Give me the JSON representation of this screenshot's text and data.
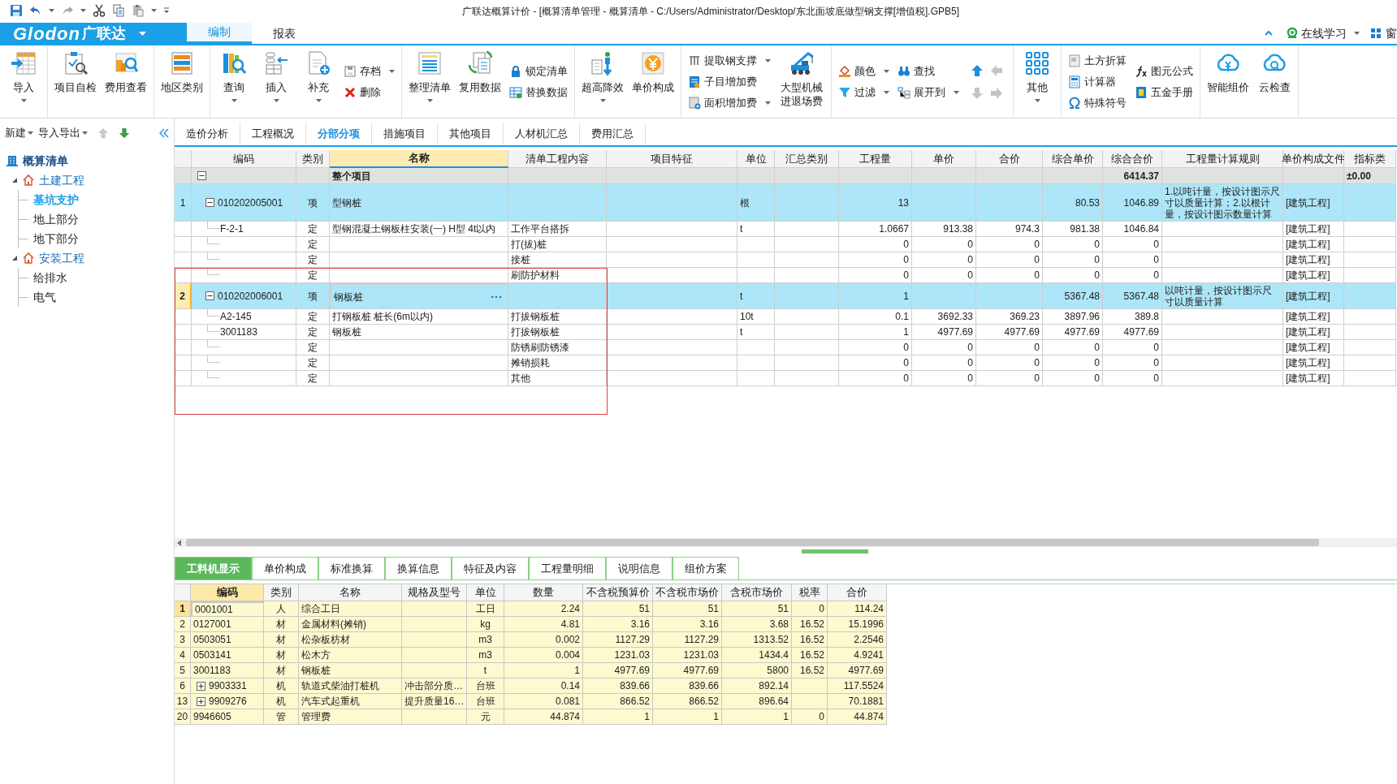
{
  "window": {
    "title": "广联达概算计价 - [概算清单管理 - 概算清单 - C:/Users/Administrator/Desktop/东北面坡底做型钢支撑[增值税].GPB5]"
  },
  "menu": {
    "logo_latin": "Glodon",
    "logo_cn": "广联达",
    "tabs": [
      {
        "label": "编制",
        "selected": true
      },
      {
        "label": "报表",
        "selected": false
      }
    ],
    "right": [
      {
        "kind": "learn",
        "label": "在线学习",
        "dropdown": true
      },
      {
        "kind": "window",
        "label": "窗"
      }
    ]
  },
  "ribbon": [
    {
      "items": [
        {
          "kind": "large",
          "label": "导入",
          "dropdown": true
        }
      ]
    },
    {
      "items": [
        {
          "kind": "large",
          "label": "项目自检",
          "dropdown": false
        },
        {
          "kind": "large",
          "label": "费用查看",
          "dropdown": false
        }
      ]
    },
    {
      "items": [
        {
          "kind": "large",
          "label": "地区类别",
          "dropdown": false
        }
      ]
    },
    {
      "items": [
        {
          "kind": "large",
          "label": "查询",
          "dropdown": true
        },
        {
          "kind": "large",
          "label": "插入",
          "dropdown": true
        },
        {
          "kind": "large",
          "label": "补充",
          "dropdown": true
        },
        {
          "kind": "stack",
          "entries": [
            {
              "label": "存档",
              "dropdown": true
            },
            {
              "label": "删除",
              "dropdown": false
            }
          ]
        }
      ]
    },
    {
      "items": [
        {
          "kind": "large",
          "label": "整理清单",
          "dropdown": true
        },
        {
          "kind": "large",
          "label": "复用数据",
          "dropdown": false
        },
        {
          "kind": "stack",
          "entries": [
            {
              "label": "锁定清单",
              "dropdown": false
            },
            {
              "label": "替换数据",
              "dropdown": false
            }
          ]
        }
      ]
    },
    {
      "items": [
        {
          "kind": "large",
          "label": "超高降效",
          "dropdown": true
        },
        {
          "kind": "large",
          "label": "单价构成",
          "dropdown": false
        }
      ]
    },
    {
      "items": [
        {
          "kind": "stack",
          "entries": [
            {
              "label": "提取钢支撑",
              "dropdown": true
            },
            {
              "label": "子目增加费",
              "dropdown": false
            },
            {
              "label": "面积增加费",
              "dropdown": true
            }
          ]
        },
        {
          "kind": "large",
          "label": "大型机械进退场费",
          "dropdown": false
        }
      ]
    },
    {
      "items": [
        {
          "kind": "stack",
          "entries": [
            {
              "label": "颜色",
              "dropdown": true
            },
            {
              "label": "过滤",
              "dropdown": true
            }
          ]
        },
        {
          "kind": "stack",
          "entries": [
            {
              "label": "查找",
              "dropdown": false
            },
            {
              "label": "展开到",
              "dropdown": true
            }
          ]
        },
        {
          "kind": "arrows",
          "buttons": [
            {
              "disabled": false
            },
            {
              "disabled": true
            },
            {
              "disabled": true
            },
            {
              "disabled": true
            }
          ]
        }
      ]
    },
    {
      "items": [
        {
          "kind": "large",
          "label": "其他",
          "dropdown": true
        }
      ]
    },
    {
      "items": [
        {
          "kind": "stack",
          "entries": [
            {
              "label": "土方折算",
              "dropdown": false
            },
            {
              "label": "计算器",
              "dropdown": false
            },
            {
              "label": "特殊符号",
              "dropdown": false
            }
          ]
        },
        {
          "kind": "stack",
          "entries": [
            {
              "label": "图元公式",
              "dropdown": false
            },
            {
              "label": "五金手册",
              "dropdown": false
            }
          ]
        }
      ]
    },
    {
      "items": [
        {
          "kind": "large",
          "label": "智能组价",
          "dropdown": false
        },
        {
          "kind": "large",
          "label": "云检查",
          "dropdown": false
        }
      ]
    }
  ],
  "sidebar": {
    "toolbar": [
      {
        "label": "新建",
        "dropdown": true
      },
      {
        "label": "导入导出",
        "dropdown": true
      }
    ],
    "move_buttons": [
      {
        "disabled": true
      },
      {
        "disabled": false
      }
    ],
    "tree": {
      "label": "概算清单",
      "children": [
        {
          "label": "土建工程",
          "expanded": true,
          "selected": false,
          "children": [
            {
              "label": "基坑支护",
              "selected": true
            },
            {
              "label": "地上部分",
              "selected": false
            },
            {
              "label": "地下部分",
              "selected": false
            }
          ]
        },
        {
          "label": "安装工程",
          "expanded": true,
          "selected": false,
          "children": [
            {
              "label": "给排水",
              "selected": false
            },
            {
              "label": "电气",
              "selected": false
            }
          ]
        }
      ]
    }
  },
  "tabs": [
    {
      "label": "造价分析",
      "selected": false
    },
    {
      "label": "工程概况",
      "selected": false
    },
    {
      "label": "分部分项",
      "selected": true
    },
    {
      "label": "措施项目",
      "selected": false
    },
    {
      "label": "其他项目",
      "selected": false
    },
    {
      "label": "人材机汇总",
      "selected": false
    },
    {
      "label": "费用汇总",
      "selected": false
    }
  ],
  "table": {
    "columns": [
      {
        "label": "编码",
        "selected": false
      },
      {
        "label": "类别",
        "selected": false
      },
      {
        "label": "名称",
        "selected": true
      },
      {
        "label": "清单工程内容",
        "selected": false
      },
      {
        "label": "项目特征",
        "selected": false
      },
      {
        "label": "单位",
        "selected": false
      },
      {
        "label": "汇总类别",
        "selected": false
      },
      {
        "label": "工程量",
        "selected": false
      },
      {
        "label": "单价",
        "selected": false
      },
      {
        "label": "合价",
        "selected": false
      },
      {
        "label": "综合单价",
        "selected": false
      },
      {
        "label": "综合合价",
        "selected": false
      },
      {
        "label": "工程量计算规则",
        "selected": false
      },
      {
        "label": "单价构成文件",
        "selected": false
      },
      {
        "label": "指标类",
        "selected": false
      }
    ],
    "rows": [
      {
        "kind": "group",
        "selected": false,
        "expanded": true,
        "name": "整个项目",
        "comp_total": "6414.37",
        "index": "±0.00"
      },
      {
        "kind": "item",
        "selected": false,
        "expanded": true,
        "no": "1",
        "code": "010202005001",
        "type": "项",
        "name": "型钢桩",
        "unit": "根",
        "qty": "13",
        "comp_price": "80.53",
        "comp_total": "1046.89",
        "rule": "1.以吨计量，按设计图示尺寸以质量计算；2.以根计量，按设计图示数量计算",
        "file": "[建筑工程]"
      },
      {
        "kind": "sub",
        "selected": false,
        "code": "F-2-1",
        "type": "定",
        "name": "型钢混凝土钢板柱安装(一) H型 4t以内",
        "content": "工作平台搭拆",
        "unit": "t",
        "qty": "1.0667",
        "price": "913.38",
        "total": "974.3",
        "comp_price": "981.38",
        "comp_total": "1046.84",
        "file": "[建筑工程]"
      },
      {
        "kind": "sub",
        "selected": false,
        "type": "定",
        "content": "打(拔)桩",
        "qty": "0",
        "price": "0",
        "total": "0",
        "comp_price": "0",
        "comp_total": "0",
        "file": "[建筑工程]"
      },
      {
        "kind": "sub",
        "selected": false,
        "type": "定",
        "content": "接桩",
        "qty": "0",
        "price": "0",
        "total": "0",
        "comp_price": "0",
        "comp_total": "0",
        "file": "[建筑工程]"
      },
      {
        "kind": "sub",
        "selected": false,
        "type": "定",
        "content": "刷防护材料",
        "qty": "0",
        "price": "0",
        "total": "0",
        "comp_price": "0",
        "comp_total": "0",
        "file": "[建筑工程]"
      },
      {
        "kind": "item",
        "selected": true,
        "expanded": true,
        "no": "2",
        "code": "010202006001",
        "type": "项",
        "name": "钢板桩",
        "unit": "t",
        "qty": "1",
        "comp_price": "5367.48",
        "comp_total": "5367.48",
        "rule": "以吨计量，按设计图示尺寸以质量计算",
        "file": "[建筑工程]"
      },
      {
        "kind": "sub",
        "selected": false,
        "code": "A2-145",
        "type": "定",
        "name": "打钢板桩 桩长(6m以内)",
        "content": "打拔钢板桩",
        "unit": "10t",
        "qty": "0.1",
        "price": "3692.33",
        "total": "369.23",
        "comp_price": "3897.96",
        "comp_total": "389.8",
        "file": "[建筑工程]"
      },
      {
        "kind": "sub",
        "selected": false,
        "code": "3001183",
        "type": "定",
        "name": "钢板桩",
        "content": "打拔钢板桩",
        "unit": "t",
        "qty": "1",
        "price": "4977.69",
        "total": "4977.69",
        "comp_price": "4977.69",
        "comp_total": "4977.69",
        "file": "[建筑工程]"
      },
      {
        "kind": "sub",
        "selected": false,
        "type": "定",
        "content": "防锈刷防锈漆",
        "qty": "0",
        "price": "0",
        "total": "0",
        "comp_price": "0",
        "comp_total": "0",
        "file": "[建筑工程]"
      },
      {
        "kind": "sub",
        "selected": false,
        "type": "定",
        "content": "摊销损耗",
        "qty": "0",
        "price": "0",
        "total": "0",
        "comp_price": "0",
        "comp_total": "0",
        "file": "[建筑工程]"
      },
      {
        "kind": "sub",
        "selected": false,
        "type": "定",
        "content": "其他",
        "qty": "0",
        "price": "0",
        "total": "0",
        "comp_price": "0",
        "comp_total": "0",
        "file": "[建筑工程]"
      }
    ]
  },
  "detail_tabs": [
    {
      "label": "工料机显示",
      "selected": true
    },
    {
      "label": "单价构成",
      "selected": false
    },
    {
      "label": "标准换算",
      "selected": false
    },
    {
      "label": "换算信息",
      "selected": false
    },
    {
      "label": "特征及内容",
      "selected": false
    },
    {
      "label": "工程量明细",
      "selected": false
    },
    {
      "label": "说明信息",
      "selected": false
    },
    {
      "label": "组价方案",
      "selected": false
    }
  ],
  "detail_table": {
    "columns": [
      {
        "label": "编码",
        "selected": true
      },
      {
        "label": "类别",
        "selected": false
      },
      {
        "label": "名称",
        "selected": false
      },
      {
        "label": "规格及型号",
        "selected": false
      },
      {
        "label": "单位",
        "selected": false
      },
      {
        "label": "数量",
        "selected": false
      },
      {
        "label": "不含税预算价",
        "selected": false
      },
      {
        "label": "不含税市场价",
        "selected": false
      },
      {
        "label": "含税市场价",
        "selected": false
      },
      {
        "label": "税率",
        "selected": false
      },
      {
        "label": "合价",
        "selected": false
      }
    ],
    "rows": [
      {
        "no": "1",
        "selected": true,
        "code": "0001001",
        "type": "人",
        "name": "综合工日",
        "unit": "工日",
        "qty": "2.24",
        "budget": "51",
        "market": "51",
        "market_tax": "51",
        "rate": "0",
        "total": "114.24"
      },
      {
        "no": "2",
        "selected": false,
        "code": "0127001",
        "type": "材",
        "name": "金属材料(摊销)",
        "unit": "kg",
        "qty": "4.81",
        "budget": "3.16",
        "market": "3.16",
        "market_tax": "3.68",
        "rate": "16.52",
        "total": "15.1996"
      },
      {
        "no": "3",
        "selected": false,
        "code": "0503051",
        "type": "材",
        "name": "松杂板枋材",
        "unit": "m3",
        "qty": "0.002",
        "budget": "1127.29",
        "market": "1127.29",
        "market_tax": "1313.52",
        "rate": "16.52",
        "total": "2.2546"
      },
      {
        "no": "4",
        "selected": false,
        "code": "0503141",
        "type": "材",
        "name": "松木方",
        "unit": "m3",
        "qty": "0.004",
        "budget": "1231.03",
        "market": "1231.03",
        "market_tax": "1434.4",
        "rate": "16.52",
        "total": "4.9241"
      },
      {
        "no": "5",
        "selected": false,
        "code": "3001183",
        "type": "材",
        "name": "钢板桩",
        "unit": "t",
        "qty": "1",
        "budget": "4977.69",
        "market": "4977.69",
        "market_tax": "5800",
        "rate": "16.52",
        "total": "4977.69"
      },
      {
        "no": "6",
        "selected": false,
        "expanded": false,
        "code": "9903331",
        "type": "机",
        "name": "轨道式柴油打桩机",
        "spec": "冲击部分质…",
        "unit": "台班",
        "qty": "0.14",
        "budget": "839.66",
        "market": "839.66",
        "market_tax": "892.14",
        "total": "117.5524"
      },
      {
        "no": "13",
        "selected": false,
        "expanded": false,
        "code": "9909276",
        "type": "机",
        "name": "汽车式起重机",
        "spec": "提升质量16…",
        "unit": "台班",
        "qty": "0.081",
        "budget": "866.52",
        "market": "866.52",
        "market_tax": "896.64",
        "total": "70.1881"
      },
      {
        "no": "20",
        "selected": false,
        "code": "9946605",
        "type": "管",
        "name": "管理费",
        "unit": "元",
        "qty": "44.874",
        "budget": "1",
        "market": "1",
        "market_tax": "1",
        "rate": "0",
        "total": "44.874"
      }
    ]
  }
}
